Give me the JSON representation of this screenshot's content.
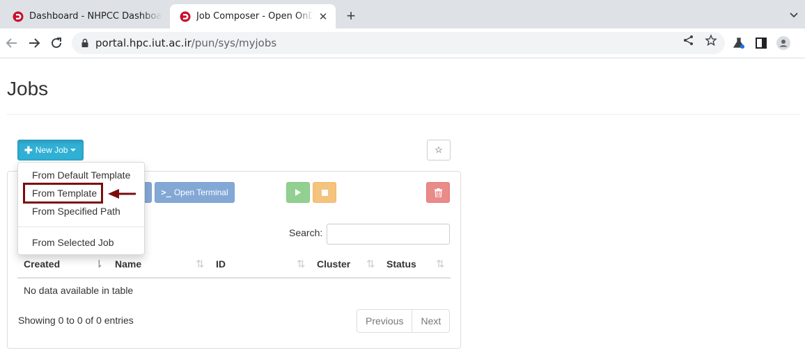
{
  "browser": {
    "tabs": [
      {
        "title": "Dashboard - NHPCC Dashboard",
        "active": false
      },
      {
        "title": "Job Composer - Open OnDemand",
        "active": true
      }
    ],
    "address": {
      "host": "portal.hpc.iut.ac.ir",
      "path": "/pun/sys/myjobs"
    },
    "brand_color": "#c8102e"
  },
  "page": {
    "title": "Jobs",
    "new_job_label": "New Job",
    "star_glyph": "☆",
    "actions": {
      "open_terminal": "Open Terminal",
      "terminal_glyph": ">_"
    },
    "search_label": "Search:",
    "table": {
      "columns": [
        "Created",
        "Name",
        "ID",
        "Cluster",
        "Status"
      ],
      "empty_text": "No data available in table"
    },
    "info": "Showing 0 to 0 of 0 entries",
    "pager": {
      "previous": "Previous",
      "next": "Next"
    }
  },
  "menu": {
    "items": [
      "From Default Template",
      "From Template",
      "From Specified Path"
    ],
    "after_divider": "From Selected Job",
    "highlighted": "From Template",
    "highlight_color": "#7b0c0c"
  }
}
